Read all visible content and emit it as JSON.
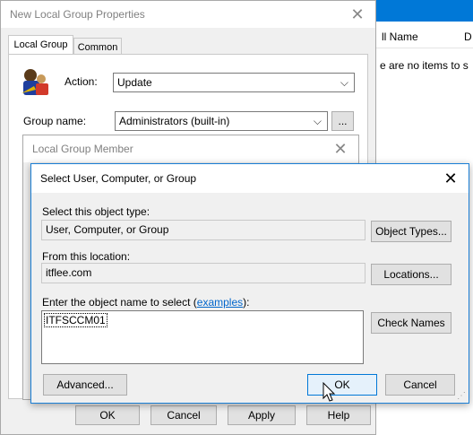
{
  "background": {
    "col_name": "ll Name",
    "col_d": "D",
    "empty_text": "e are no items to s"
  },
  "props_window": {
    "title": "New Local Group Properties",
    "tabs": [
      "Local Group",
      "Common"
    ],
    "action_label": "Action:",
    "action_value": "Update",
    "group_name_label": "Group name:",
    "group_name_value": "Administrators (built-in)",
    "browse_label": "...",
    "buttons": {
      "ok": "OK",
      "cancel": "Cancel",
      "apply": "Apply",
      "help": "Help"
    }
  },
  "member_window": {
    "title": "Local Group Member"
  },
  "select_dialog": {
    "title": "Select User, Computer, or Group",
    "object_type_label": "Select this object type:",
    "object_type_value": "User, Computer, or Group",
    "object_types_button": "Object Types...",
    "location_label": "From this location:",
    "location_value": "itflee.com",
    "locations_button": "Locations...",
    "enter_label_prefix": "Enter the object name to select (",
    "examples_link": "examples",
    "enter_label_suffix": "):",
    "object_name_value": "ITFSCCM01",
    "check_names_button": "Check Names",
    "advanced_button": "Advanced...",
    "ok_button": "OK",
    "cancel_button": "Cancel"
  }
}
